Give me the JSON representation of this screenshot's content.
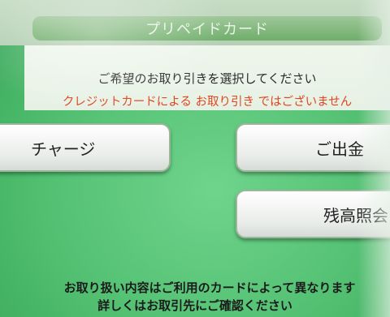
{
  "header": {
    "title": "プリペイドカード"
  },
  "prompt": {
    "main": "ご希望のお取り引きを選択してください",
    "warning": "クレジットカードによる お取り引き ではございません"
  },
  "buttons": {
    "charge": "チャージ",
    "withdraw": "ご出金",
    "balance": "残高照会"
  },
  "footer": {
    "line1": "お取り扱い内容はご利用のカードによって異なります",
    "line2": "詳しくはお取引先にご確認ください"
  },
  "colors": {
    "background": "#58c477",
    "warning_text": "#e0451f",
    "button_face": "#ffffff"
  }
}
